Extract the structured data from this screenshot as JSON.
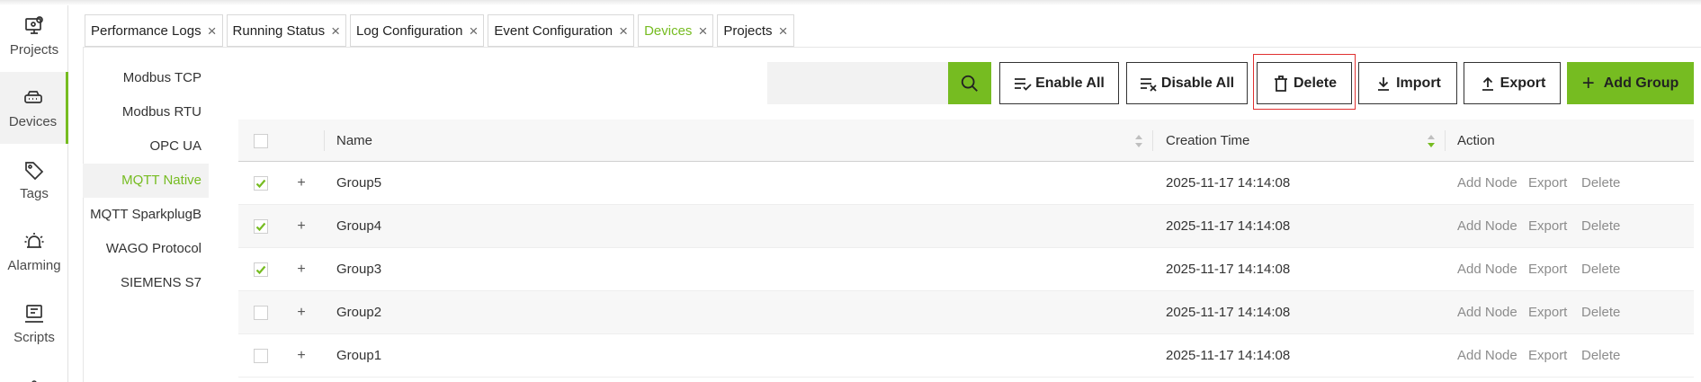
{
  "rail": {
    "items": [
      {
        "label": "Projects",
        "icon": "projects-icon"
      },
      {
        "label": "Devices",
        "icon": "devices-icon"
      },
      {
        "label": "Tags",
        "icon": "tag-icon"
      },
      {
        "label": "Alarming",
        "icon": "alarm-icon"
      },
      {
        "label": "Scripts",
        "icon": "scripts-icon"
      }
    ]
  },
  "tabs": [
    {
      "label": "Performance Logs"
    },
    {
      "label": "Running Status"
    },
    {
      "label": "Log Configuration"
    },
    {
      "label": "Event Configuration"
    },
    {
      "label": "Devices"
    },
    {
      "label": "Projects"
    }
  ],
  "tab_close_glyph": "×",
  "protocols": [
    "Modbus TCP",
    "Modbus RTU",
    "OPC UA",
    "MQTT Native",
    "MQTT SparkplugB",
    "WAGO Protocol",
    "SIEMENS S7"
  ],
  "toolbar": {
    "search_value": "",
    "enable_all": "Enable All",
    "disable_all": "Disable All",
    "delete": "Delete",
    "import": "Import",
    "export": "Export",
    "add_group": "Add Group"
  },
  "table": {
    "columns": {
      "name": "Name",
      "creation_time": "Creation Time",
      "action": "Action"
    },
    "expand_glyph": "+",
    "rows": [
      {
        "name": "Group5",
        "time": "2025-11-17 14:14:08",
        "checked": true
      },
      {
        "name": "Group4",
        "time": "2025-11-17 14:14:08",
        "checked": true
      },
      {
        "name": "Group3",
        "time": "2025-11-17 14:14:08",
        "checked": true
      },
      {
        "name": "Group2",
        "time": "2025-11-17 14:14:08",
        "checked": false
      },
      {
        "name": "Group1",
        "time": "2025-11-17 14:14:08",
        "checked": false
      }
    ],
    "actions": {
      "add_node": "Add Node",
      "export": "Export",
      "delete": "Delete"
    }
  },
  "colors": {
    "accent": "#76bc21",
    "highlight": "#e03030"
  }
}
